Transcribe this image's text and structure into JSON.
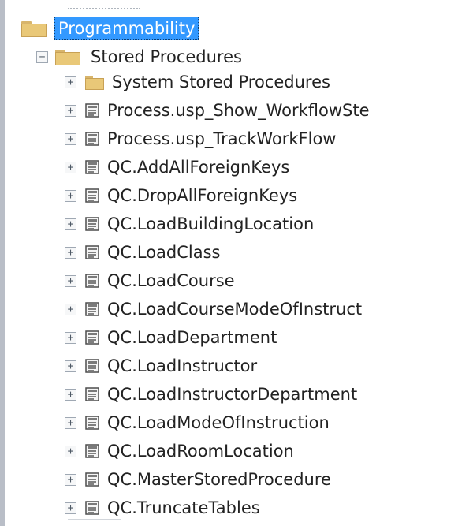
{
  "tree": {
    "root": {
      "label": "Programmability",
      "selected": true
    },
    "stored_procedures": {
      "label": "Stored Procedures",
      "expanded": true,
      "expander_symbol": "−"
    },
    "expander_plus": "+",
    "items": [
      {
        "label": "System Stored Procedures",
        "icon": "folder-icon"
      },
      {
        "label": "Process.usp_Show_WorkflowSte",
        "icon": "stored-procedure-icon"
      },
      {
        "label": "Process.usp_TrackWorkFlow",
        "icon": "stored-procedure-icon"
      },
      {
        "label": "QC.AddAllForeignKeys",
        "icon": "stored-procedure-icon"
      },
      {
        "label": "QC.DropAllForeignKeys",
        "icon": "stored-procedure-icon"
      },
      {
        "label": "QC.LoadBuildingLocation",
        "icon": "stored-procedure-icon"
      },
      {
        "label": "QC.LoadClass",
        "icon": "stored-procedure-icon"
      },
      {
        "label": "QC.LoadCourse",
        "icon": "stored-procedure-icon"
      },
      {
        "label": "QC.LoadCourseModeOfInstruct",
        "icon": "stored-procedure-icon"
      },
      {
        "label": "QC.LoadDepartment",
        "icon": "stored-procedure-icon"
      },
      {
        "label": "QC.LoadInstructor",
        "icon": "stored-procedure-icon"
      },
      {
        "label": "QC.LoadInstructorDepartment",
        "icon": "stored-procedure-icon"
      },
      {
        "label": "QC.LoadModeOfInstruction",
        "icon": "stored-procedure-icon"
      },
      {
        "label": "QC.LoadRoomLocation",
        "icon": "stored-procedure-icon"
      },
      {
        "label": "QC.MasterStoredProcedure",
        "icon": "stored-procedure-icon"
      },
      {
        "label": "QC.TruncateTables",
        "icon": "stored-procedure-icon"
      }
    ]
  }
}
